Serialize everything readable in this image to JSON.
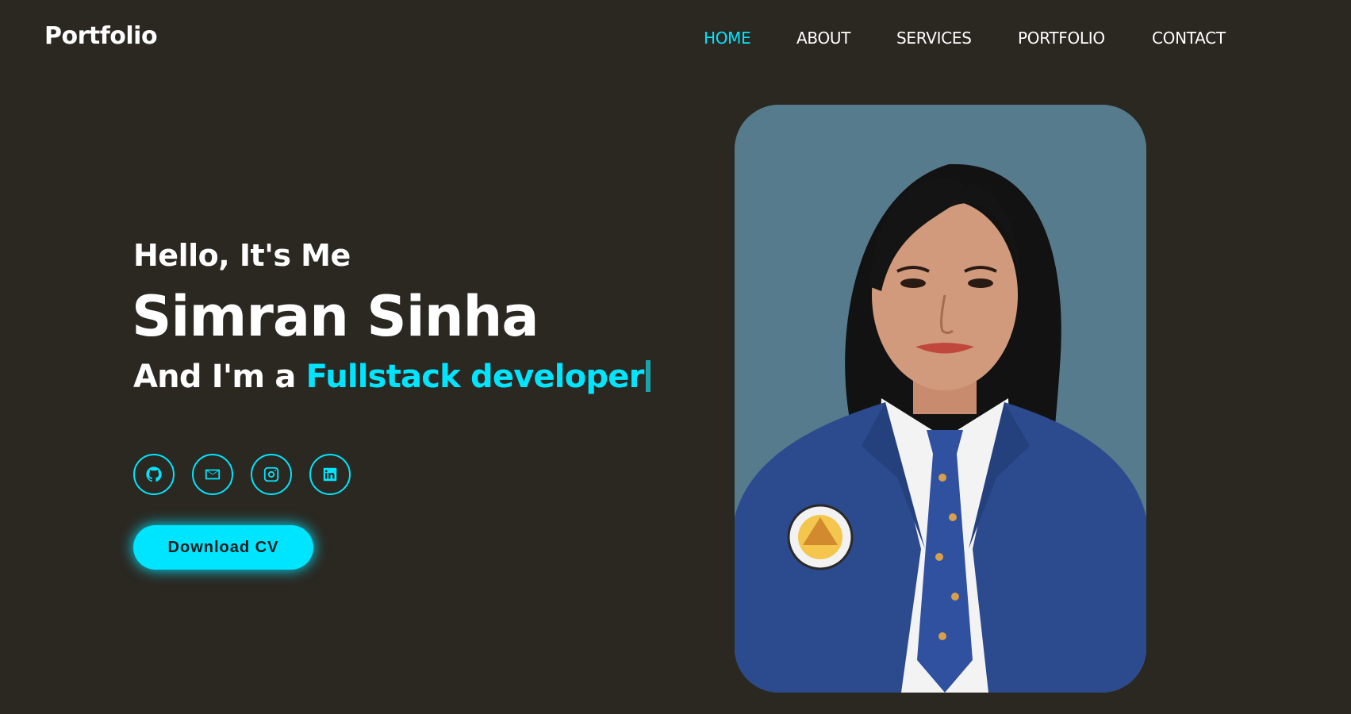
{
  "header": {
    "logo": "Portfolio",
    "nav": [
      {
        "label": "HOME",
        "active": true
      },
      {
        "label": "ABOUT",
        "active": false
      },
      {
        "label": "SERVICES",
        "active": false
      },
      {
        "label": "PORTFOLIO",
        "active": false
      },
      {
        "label": "CONTACT",
        "active": false
      }
    ]
  },
  "hero": {
    "greeting": "Hello, It's Me",
    "name": "Simran Sinha",
    "role_prefix": "And I'm a ",
    "role_highlight": "Fullstack developer",
    "socials": [
      {
        "icon": "github-icon"
      },
      {
        "icon": "mail-icon"
      },
      {
        "icon": "instagram-icon"
      },
      {
        "icon": "linkedin-icon"
      }
    ],
    "cta_label": "Download CV"
  },
  "colors": {
    "background": "#2b2721",
    "accent": "#00e5ff",
    "photo_bg": "#567b8d"
  }
}
